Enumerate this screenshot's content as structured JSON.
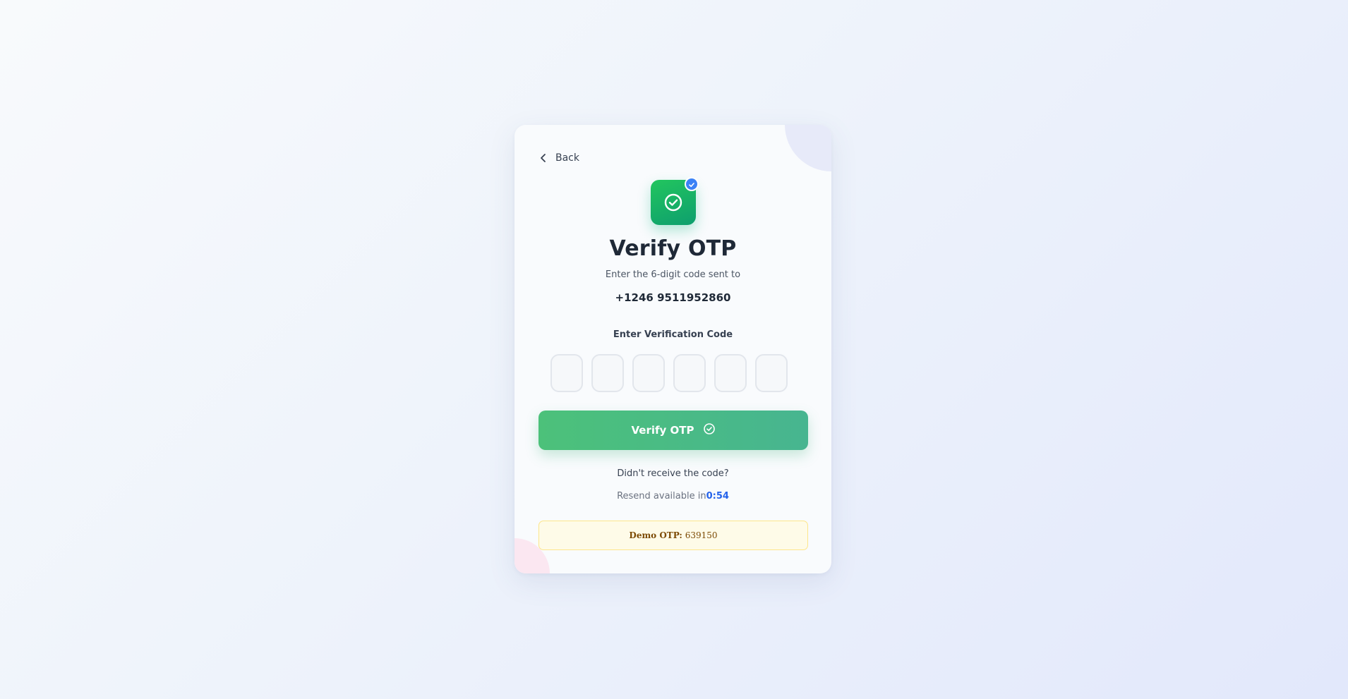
{
  "nav": {
    "back_label": "Back"
  },
  "header": {
    "logo_icon": "check-circle-icon",
    "badge_icon": "check-icon",
    "title": "Verify OTP",
    "subtitle": "Enter the 6-digit code sent to",
    "phone": "+1246 9511952860"
  },
  "form": {
    "code_label": "Enter Verification Code",
    "digits": [
      "",
      "",
      "",
      "",
      "",
      ""
    ],
    "submit_label": "Verify OTP",
    "submit_icon": "check-circle-icon"
  },
  "resend": {
    "prompt": "Didn't receive the code?",
    "available_text": "Resend available in",
    "timer": "0:54"
  },
  "demo": {
    "label": "Demo OTP:",
    "code": "639150"
  },
  "colors": {
    "accent_green": "#22c55e",
    "badge_blue": "#3b82f6",
    "timer_blue": "#2563eb",
    "demo_bg": "#fefbe8"
  }
}
